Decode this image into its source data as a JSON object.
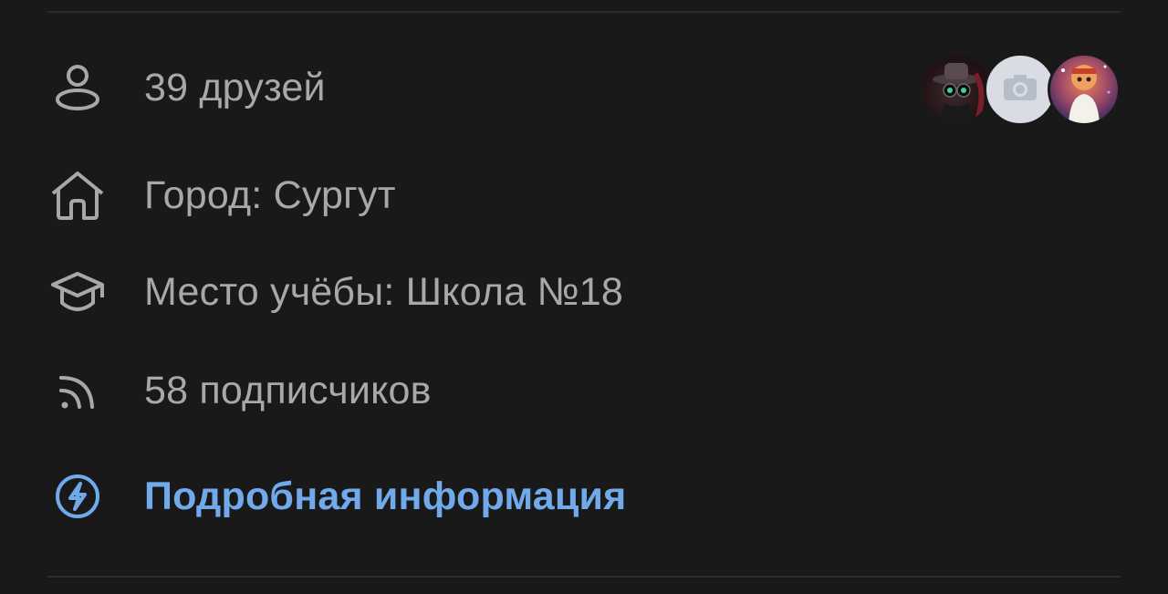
{
  "profile_info": {
    "friends": {
      "label": "39 друзей",
      "icon": "user-icon",
      "avatars": [
        {
          "name": "friend-avatar-1"
        },
        {
          "name": "friend-avatar-2-placeholder",
          "icon": "camera-icon"
        },
        {
          "name": "friend-avatar-3"
        }
      ]
    },
    "city": {
      "label": "Город: Сургут",
      "icon": "home-icon"
    },
    "school": {
      "label": "Место учёбы: Школа №18",
      "icon": "graduation-cap-icon"
    },
    "subscribers": {
      "label": "58 подписчиков",
      "icon": "rss-icon"
    },
    "details": {
      "label": "Подробная информация",
      "icon": "lightning-circle-icon"
    }
  },
  "colors": {
    "background": "#19191a",
    "text_secondary": "#a8a8ab",
    "accent": "#71aaeb",
    "divider": "#2b2b2d"
  }
}
